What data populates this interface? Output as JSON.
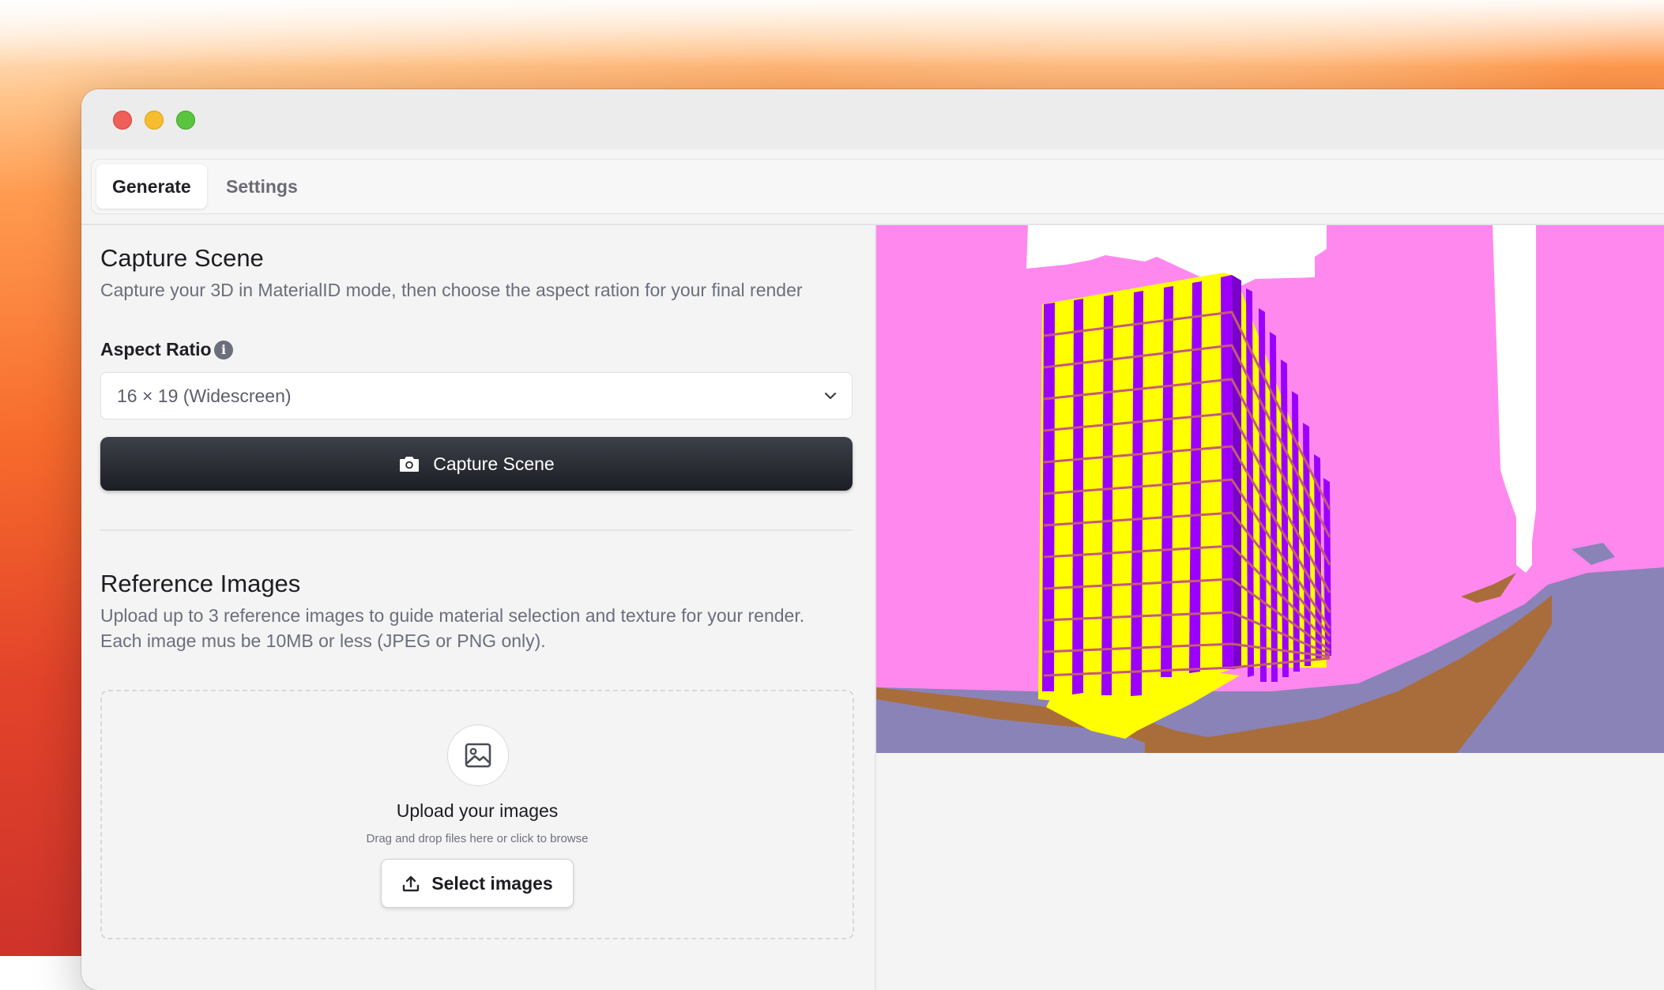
{
  "tabs": [
    {
      "label": "Generate",
      "active": true
    },
    {
      "label": "Settings",
      "active": false
    }
  ],
  "capture": {
    "title": "Capture Scene",
    "description": "Capture your 3D in MaterialID mode, then choose the aspect ration for your final render",
    "aspect_label": "Aspect Ratio",
    "aspect_value": "16 × 19 (Widescreen)",
    "button_label": "Capture Scene"
  },
  "reference": {
    "title": "Reference Images",
    "description_line1": "Upload up to 3 reference images to guide material selection and texture for your render.",
    "description_line2": "Each image mus be 10MB or less (JPEG or PNG only).",
    "upload_title": "Upload your images",
    "upload_subtitle": "Drag and drop files here or click to browse",
    "select_button": "Select images"
  },
  "icons": {
    "info": "info-icon",
    "chevron": "chevron-down-icon",
    "camera": "camera-icon",
    "image": "image-icon",
    "upload": "upload-icon"
  },
  "colors": {
    "primary_button": "#23262c",
    "materialid_sky": "#ff88ee",
    "materialid_glass": "#ffff00",
    "materialid_mullion": "#9b00ff",
    "materialid_road": "#a86d3a",
    "materialid_pavement": "#8a83b8"
  }
}
